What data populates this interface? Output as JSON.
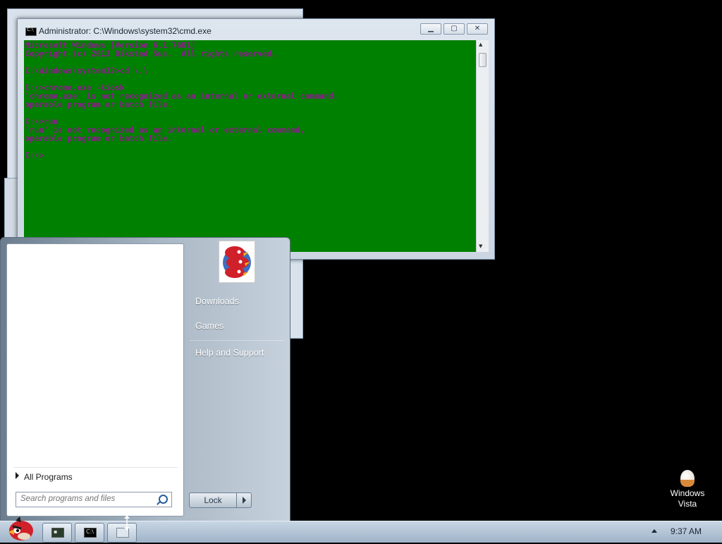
{
  "cmd": {
    "title": "Administrator: C:\\Windows\\system32\\cmd.exe",
    "console_text": "Microsoft Windows [Version 6.1.7601]\nCopyright (c) 2013 Diksted Sus.  All rights reserved.\n\nC:\\Windows\\system32>cd \\.\\\n\nC:\\>chrome.exe -kiosk\n'chrome.exe' is not recognized as an internal or external command,\noperable program or batch file.\n\nC:\\>run\n'run' is not recognized as an internal or external command,\noperable program or batch file.\n\nC:\\>",
    "console_bg": "#008000",
    "console_fg": "#8b1a8b"
  },
  "start_menu": {
    "right_items": [
      "Downloads",
      "Games",
      "Help and Support"
    ],
    "all_programs": "All Programs",
    "search_placeholder": "Search programs and files",
    "lock_label": "Lock"
  },
  "taskbar": {
    "clock": "9:37 AM"
  },
  "desktop_icon": {
    "line1": "Windows",
    "line2": "Vista"
  }
}
